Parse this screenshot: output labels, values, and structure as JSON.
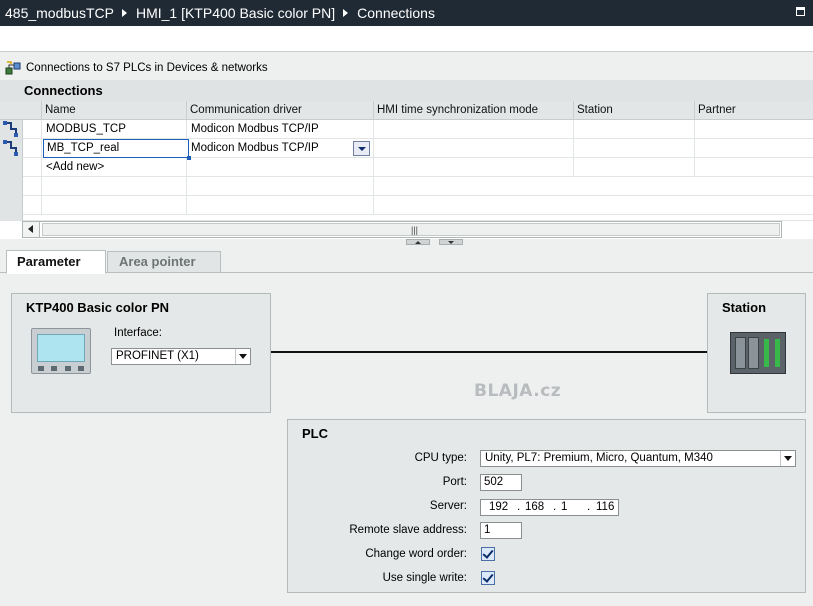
{
  "breadcrumb": {
    "project": "485_modbusTCP",
    "device": "HMI_1 [KTP400 Basic color PN]",
    "page": "Connections"
  },
  "info_bar": {
    "text": "Connections to S7 PLCs in Devices & networks"
  },
  "connections": {
    "title": "Connections",
    "columns": [
      "Name",
      "Communication driver",
      "HMI time synchronization mode",
      "Station",
      "Partner"
    ],
    "rows": [
      {
        "name": "MODBUS_TCP",
        "driver": "Modicon Modbus TCP/IP"
      },
      {
        "name": "MB_TCP_real",
        "driver": "Modicon Modbus TCP/IP"
      }
    ],
    "add_new": "<Add new>",
    "scroll_thumb_glyph": "|||"
  },
  "tabs": {
    "parameter": "Parameter",
    "area_pointer": "Area pointer"
  },
  "hmi": {
    "title": "KTP400 Basic color PN",
    "interface_label": "Interface:",
    "interface_value": "PROFINET (X1)"
  },
  "station": {
    "title": "Station"
  },
  "watermark": "BLAJA.cz",
  "plc": {
    "title": "PLC",
    "cpu_type_label": "CPU type:",
    "cpu_type_value": "Unity, PL7: Premium, Micro, Quantum, M340",
    "port_label": "Port:",
    "port_value": "502",
    "server_label": "Server:",
    "server_octets": [
      "192",
      "168",
      "1",
      "116"
    ],
    "remote_slave_label": "Remote slave address:",
    "remote_slave_value": "1",
    "change_word_order_label": "Change word order:",
    "change_word_order_checked": true,
    "single_write_label": "Use single write:",
    "single_write_checked": true
  },
  "colors": {
    "titlebar_bg": "#1f2a35",
    "selection_border": "#1f5fb8",
    "panel_bg": "#e5e8e8"
  }
}
